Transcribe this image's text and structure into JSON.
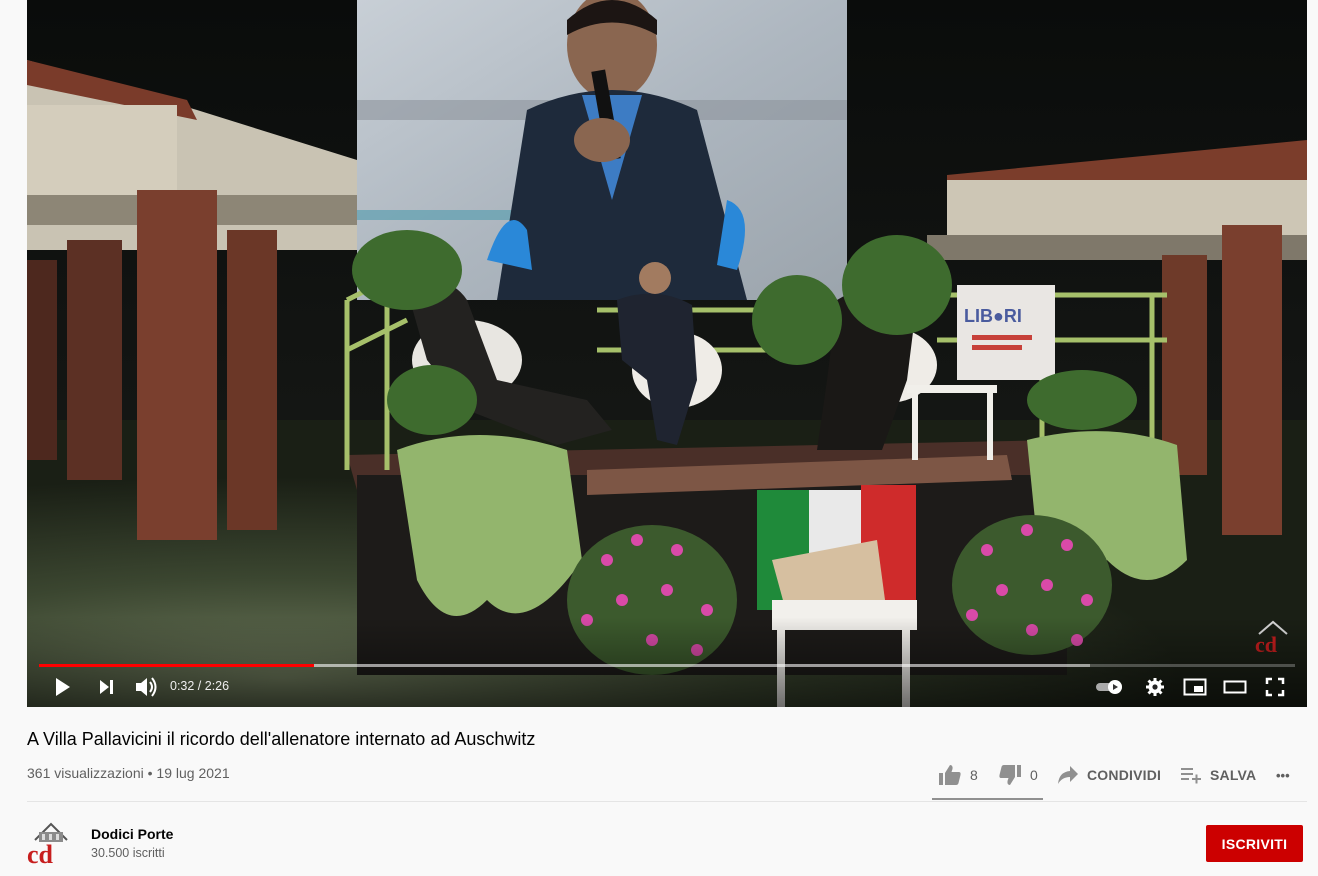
{
  "player": {
    "time_display": "0:32 / 2:26",
    "progress_played_fraction": 0.2188,
    "progress_loaded_fraction": 0.8365,
    "colors": {
      "progress": "#ff0000",
      "controls": "#ffffff"
    },
    "scene": {
      "banner_text": "LIB●RI",
      "flag_colors": [
        "#1f8a3a",
        "#f1f1f1",
        "#cf2b2b"
      ]
    }
  },
  "video": {
    "title": "A Villa Pallavicini il ricordo dell'allenatore internato ad Auschwitz",
    "views": "361 visualizzazioni",
    "separator": "•",
    "date": "19 lug 2021"
  },
  "actions": {
    "likes": "8",
    "dislikes": "0",
    "share_label": "CONDIVIDI",
    "save_label": "SALVA",
    "more_label": "•••"
  },
  "channel": {
    "name": "Dodici Porte",
    "subscribers": "30.500 iscritti",
    "subscribe_label": "ISCRIVITI",
    "brand_color": "#cc0000"
  }
}
